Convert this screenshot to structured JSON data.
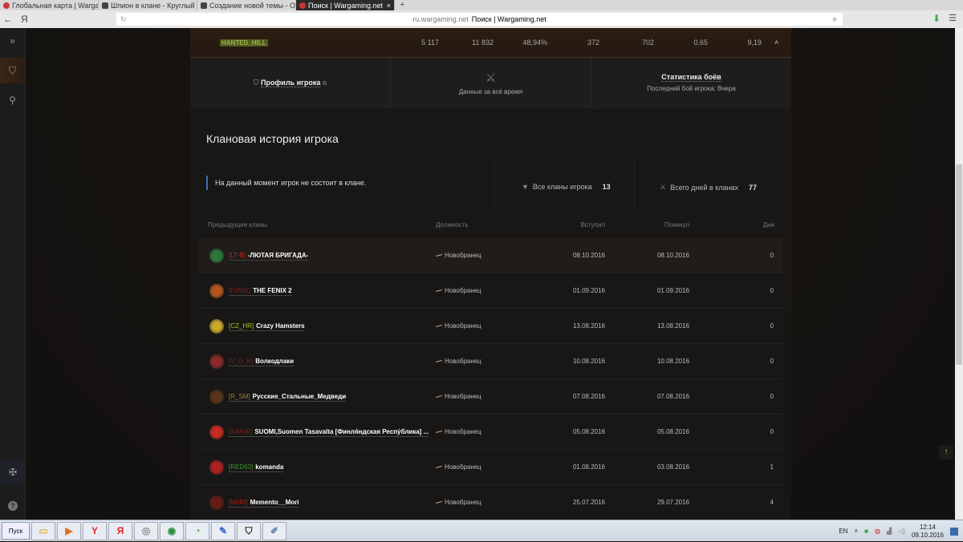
{
  "browser": {
    "tabs": [
      {
        "label": "Глобальная карта | Wargaming"
      },
      {
        "label": "Шпион в клане - Круглый"
      },
      {
        "label": "Создание новой темы - Оф"
      },
      {
        "label": "Поиск | Wargaming.net",
        "active": true
      }
    ],
    "back_label": "←",
    "yandex_label": "Я",
    "url_host": "ru.wargaming.net",
    "url_title": "Поиск | Wargaming.net"
  },
  "player": {
    "name": "HANTED_HILL",
    "stats": [
      "5 117",
      "11 832",
      "48,94%",
      "372",
      "702",
      "0,65",
      "9,19"
    ]
  },
  "cards": {
    "profile": "Профиль игрока",
    "period": "Данные за всё время",
    "battle_stats": "Статистика боёв",
    "last_battle": "Последний бой игрока: Вчера"
  },
  "history": {
    "title": "Клановая история игрока",
    "current": "На данный момент игрок не состоит в клане.",
    "all_clans_label": "Все кланы игрока",
    "all_clans_value": "13",
    "days_label": "Всего дней в кланах",
    "days_value": "77",
    "columns": [
      "Предыдущие кланы",
      "Должность",
      "Вступил",
      "Покинул",
      "Дни"
    ],
    "rows": [
      {
        "tag": "[LT-B]",
        "name": "-ЛЮТАЯ БРИГАДА-",
        "role": "Новобранец",
        "joined": "08.10.2016",
        "left": "08.10.2016",
        "days": "0",
        "tag_color": "#c0281e",
        "logo_color": "#2b7a3a"
      },
      {
        "tag": "[F3NIX]",
        "name": "THE FENIX 2",
        "role": "Новобранец",
        "joined": "01.09.2016",
        "left": "01.09.2016",
        "days": "0",
        "tag_color": "#8a1e18",
        "logo_color": "#b5541e"
      },
      {
        "tag": "[CZ_HR]",
        "name": "Crazy Hamsters",
        "role": "Новобранец",
        "joined": "13.08.2016",
        "left": "13.08.2016",
        "days": "0",
        "tag_color": "#a8c020",
        "logo_color": "#c9a82a"
      },
      {
        "tag": "[V_O_K]",
        "name": "Волкодлаки",
        "role": "Новобранец",
        "joined": "10.08.2016",
        "left": "10.08.2016",
        "days": "0",
        "tag_color": "#6a2a2a",
        "logo_color": "#8a2a2a"
      },
      {
        "tag": "[R_SM]",
        "name": "Русские_Стальные_Медведи",
        "role": "Новобранец",
        "joined": "07.08.2016",
        "left": "07.08.2016",
        "days": "0",
        "tag_color": "#a07a3a",
        "logo_color": "#5a3418"
      },
      {
        "tag": "[SAAMI]",
        "name": "SUOMI,Suomen Tasavalta [Финля́ндская Респу́блика] ...",
        "role": "Новобранец",
        "joined": "05.08.2016",
        "left": "05.08.2016",
        "days": "0",
        "tag_color": "#8a1e18",
        "logo_color": "#c92a22"
      },
      {
        "tag": "[RED63]",
        "name": "komanda",
        "role": "Новобранец",
        "joined": "01.08.2016",
        "left": "03.08.2016",
        "days": "1",
        "tag_color": "#3a9a2a",
        "logo_color": "#b02020"
      },
      {
        "tag": "[M0RI]",
        "name": "Memento__Mori",
        "role": "Новобранец",
        "joined": "25.07.2016",
        "left": "29.07.2016",
        "days": "4",
        "tag_color": "#a02018",
        "logo_color": "#6a1a14"
      }
    ]
  },
  "taskbar": {
    "start": "Пуск",
    "lang": "EN",
    "time": "12:14",
    "date": "09.10.2016"
  }
}
